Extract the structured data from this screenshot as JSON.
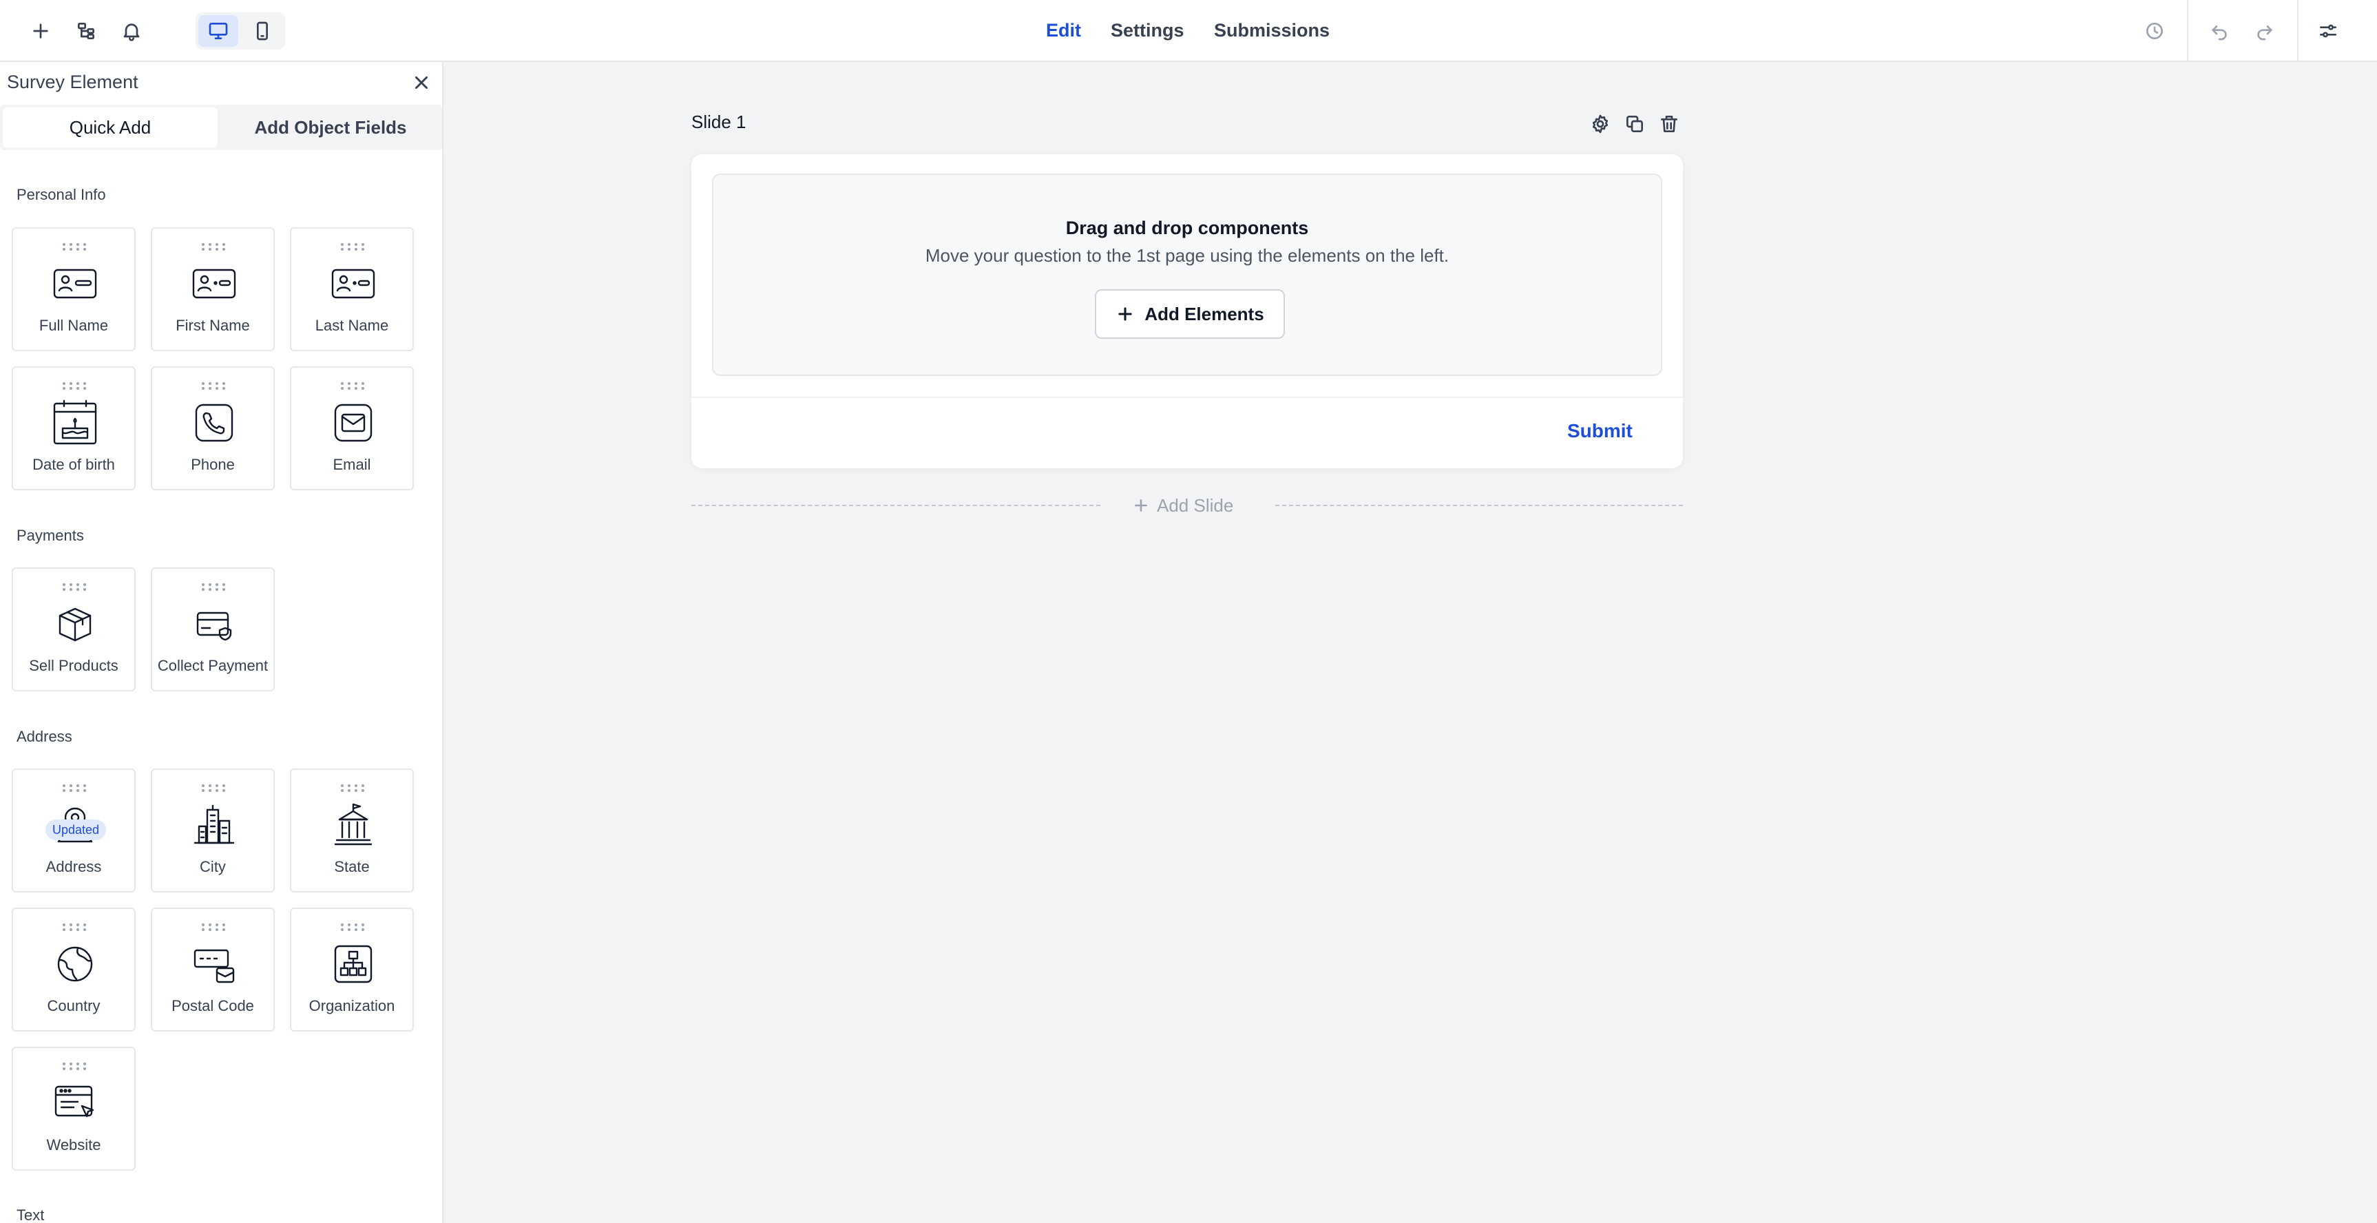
{
  "topbar": {
    "tabs": [
      {
        "label": "Edit",
        "active": true
      },
      {
        "label": "Settings",
        "active": false
      },
      {
        "label": "Submissions",
        "active": false
      }
    ],
    "device_mode": "desktop"
  },
  "sidebar": {
    "title": "Survey Element",
    "tabs": [
      {
        "label": "Quick Add",
        "active": true
      },
      {
        "label": "Add Object Fields",
        "active": false
      }
    ],
    "sections": [
      {
        "label": "Personal Info",
        "items": [
          {
            "label": "Full Name",
            "icon": "id-card-icon"
          },
          {
            "label": "First Name",
            "icon": "id-card-icon"
          },
          {
            "label": "Last Name",
            "icon": "id-card-icon"
          },
          {
            "label": "Date of birth",
            "icon": "birthday-cake-icon"
          },
          {
            "label": "Phone",
            "icon": "phone-icon"
          },
          {
            "label": "Email",
            "icon": "email-icon"
          }
        ]
      },
      {
        "label": "Payments",
        "items": [
          {
            "label": "Sell Products",
            "icon": "package-icon"
          },
          {
            "label": "Collect Payment",
            "icon": "credit-card-icon"
          }
        ]
      },
      {
        "label": "Address",
        "badge": "Updated",
        "items": [
          {
            "label": "Address",
            "icon": "map-pin-icon"
          },
          {
            "label": "City",
            "icon": "city-buildings-icon"
          },
          {
            "label": "State",
            "icon": "capitol-building-icon"
          },
          {
            "label": "Country",
            "icon": "globe-icon"
          },
          {
            "label": "Postal Code",
            "icon": "postal-code-icon"
          },
          {
            "label": "Organization",
            "icon": "organization-chart-icon"
          },
          {
            "label": "Website",
            "icon": "browser-cursor-icon"
          }
        ]
      },
      {
        "label": "Text",
        "items": []
      }
    ]
  },
  "canvas": {
    "slide_title": "Slide 1",
    "drop_title": "Drag and drop components",
    "drop_subtitle": "Move your question to the 1st page using the elements on the left.",
    "add_elements_label": "Add Elements",
    "submit_label": "Submit",
    "add_slide_label": "Add Slide"
  },
  "colors": {
    "accent": "#1d4ed8",
    "canvas_bg": "#f2f3f5",
    "badge_bg": "#e0e9fb"
  }
}
